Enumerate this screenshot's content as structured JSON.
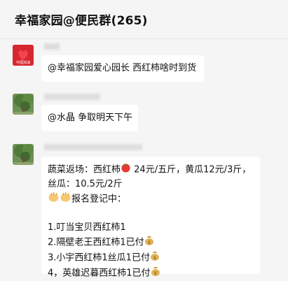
{
  "header": {
    "title": "幸福家园@便民群(265)"
  },
  "messages": [
    {
      "sender": "",
      "avatar_text": "中国加油",
      "text": "@幸福家园爱心园长 西红柿啥时到货"
    },
    {
      "sender": "",
      "text": "@水晶 争取明天下午"
    },
    {
      "sender": "",
      "lines": [
        "蔬菜返场：西红柿",
        " 24元/五斤，黄瓜12元/3斤，",
        "丝瓜：10.5元/2斤",
        "报名登记中：",
        "1.叮当宝贝西红柿1",
        "2.隔壁老王西红柿1已付",
        "3.小宇西红柿1丝瓜1已付",
        "4，英雄迟暮西红柿1已付"
      ]
    }
  ],
  "icons": {
    "tomato": "tomato-icon",
    "clap": "clap-hands-icon",
    "money_bag": "money-bag-icon"
  },
  "colors": {
    "background": "#f5f5f5",
    "bubble": "#ffffff",
    "avatar_red": "#d8262f",
    "avatar_green": "#4e7a3a"
  }
}
